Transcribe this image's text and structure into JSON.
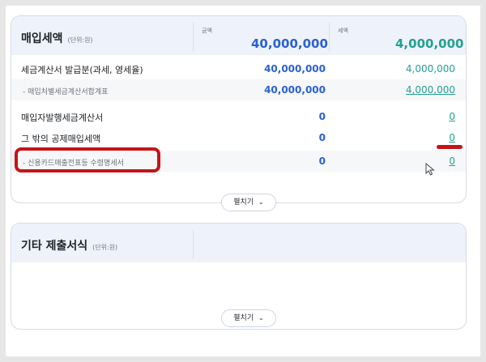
{
  "purchase_tax": {
    "title": "매입세액",
    "unit": "(단위:원)",
    "amount_label": "금액",
    "tax_label": "세액",
    "amount_total": "40,000,000",
    "tax_total": "4,000,000",
    "rows": [
      {
        "label": "세금계산서 발급분(과세, 영세율)",
        "amount": "40,000,000",
        "tax": "4,000,000"
      },
      {
        "label": "- 매입처별세금계산서합계표",
        "amount": "40,000,000",
        "tax": "4,000,000"
      },
      {
        "label": "매입자발행세금계산서",
        "amount": "0",
        "tax": "0"
      },
      {
        "label": "그 밖의 공제매입세액",
        "amount": "0",
        "tax": "0"
      },
      {
        "label": "- 신용카드매출전표등 수령명세서",
        "amount": "0",
        "tax": "0"
      }
    ],
    "expand_label": "펼치기",
    "expand_icon": "chevron-down-icon"
  },
  "other_forms": {
    "title": "기타 제출서식",
    "unit": "(단위:원)",
    "expand_label": "펼치기",
    "expand_icon": "chevron-down-icon"
  },
  "colors": {
    "amount_blue": "#2b61d1",
    "tax_teal": "#23a092",
    "highlight_red": "#c51418",
    "header_bg": "#eef3fb"
  }
}
